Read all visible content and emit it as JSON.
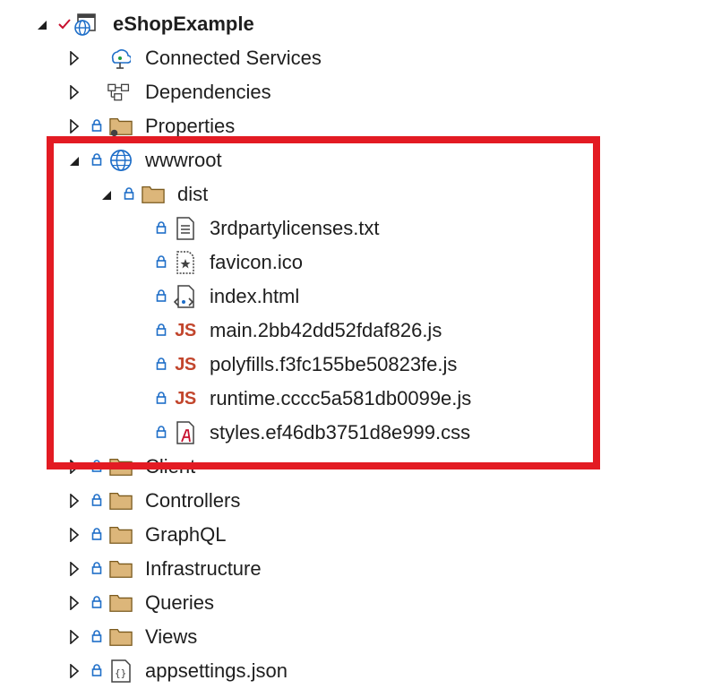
{
  "tree": {
    "project": "eShopExample",
    "connected_services": "Connected Services",
    "dependencies": "Dependencies",
    "properties": "Properties",
    "wwwroot": "wwwroot",
    "dist": "dist",
    "files": [
      {
        "name": "3rdpartylicenses.txt",
        "icon": "text-file-icon"
      },
      {
        "name": "favicon.ico",
        "icon": "icon-file-icon"
      },
      {
        "name": "index.html",
        "icon": "html-file-icon"
      },
      {
        "name": "main.2bb42dd52fdaf826.js",
        "icon": "js-file-icon",
        "badge": "JS"
      },
      {
        "name": "polyfills.f3fc155be50823fe.js",
        "icon": "js-file-icon",
        "badge": "JS"
      },
      {
        "name": "runtime.cccc5a581db0099e.js",
        "icon": "js-file-icon",
        "badge": "JS"
      },
      {
        "name": "styles.ef46db3751d8e999.css",
        "icon": "css-file-icon"
      }
    ],
    "folders": [
      "Client",
      "Controllers",
      "GraphQL",
      "Infrastructure",
      "Queries",
      "Views"
    ],
    "appsettings": "appsettings.json"
  },
  "colors": {
    "highlight": "#e31b23",
    "folder": "#dcb67a",
    "lock": "#1e6ec8",
    "js": "#c2462d",
    "globe": "#1e6ec8"
  }
}
